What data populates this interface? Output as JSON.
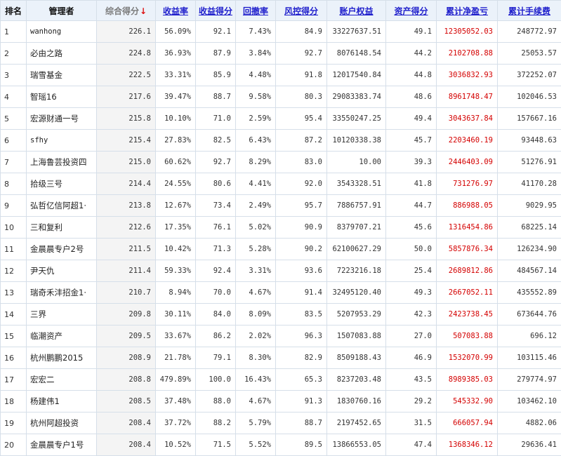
{
  "headers": {
    "rank": "排名",
    "manager": "管理者",
    "composite": "综合得分",
    "sort_arrow": "↓",
    "return_rate": "收益率",
    "return_score": "收益得分",
    "drawdown": "回撤率",
    "risk_score": "风控得分",
    "equity": "账户权益",
    "asset_score": "资产得分",
    "cum_pnl": "累计净盈亏",
    "cum_fee": "累计手续费"
  },
  "rows": [
    {
      "rank": "1",
      "manager": "wanhong",
      "composite": "226.1",
      "return_rate": "56.09%",
      "return_score": "92.1",
      "drawdown": "7.43%",
      "risk_score": "84.9",
      "equity": "33227637.51",
      "asset_score": "49.1",
      "cum_pnl": "12305052.03",
      "cum_fee": "248772.97"
    },
    {
      "rank": "2",
      "manager": "必由之路",
      "composite": "224.8",
      "return_rate": "36.93%",
      "return_score": "87.9",
      "drawdown": "3.84%",
      "risk_score": "92.7",
      "equity": "8076148.54",
      "asset_score": "44.2",
      "cum_pnl": "2102708.88",
      "cum_fee": "25053.57"
    },
    {
      "rank": "3",
      "manager": "瑞雪基金",
      "composite": "222.5",
      "return_rate": "33.31%",
      "return_score": "85.9",
      "drawdown": "4.48%",
      "risk_score": "91.8",
      "equity": "12017540.84",
      "asset_score": "44.8",
      "cum_pnl": "3036832.93",
      "cum_fee": "372252.07"
    },
    {
      "rank": "4",
      "manager": "智瑶16",
      "composite": "217.6",
      "return_rate": "39.47%",
      "return_score": "88.7",
      "drawdown": "9.58%",
      "risk_score": "80.3",
      "equity": "29083383.74",
      "asset_score": "48.6",
      "cum_pnl": "8961748.47",
      "cum_fee": "102046.53"
    },
    {
      "rank": "5",
      "manager": "宏源财通一号",
      "composite": "215.8",
      "return_rate": "10.10%",
      "return_score": "71.0",
      "drawdown": "2.59%",
      "risk_score": "95.4",
      "equity": "33550247.25",
      "asset_score": "49.4",
      "cum_pnl": "3043637.84",
      "cum_fee": "157667.16"
    },
    {
      "rank": "6",
      "manager": "sfhy",
      "composite": "215.4",
      "return_rate": "27.83%",
      "return_score": "82.5",
      "drawdown": "6.43%",
      "risk_score": "87.2",
      "equity": "10120338.38",
      "asset_score": "45.7",
      "cum_pnl": "2203460.19",
      "cum_fee": "93448.63"
    },
    {
      "rank": "7",
      "manager": "上海鲁芸投资四",
      "composite": "215.0",
      "return_rate": "60.62%",
      "return_score": "92.7",
      "drawdown": "8.29%",
      "risk_score": "83.0",
      "equity": "10.00",
      "asset_score": "39.3",
      "cum_pnl": "2446403.09",
      "cum_fee": "51276.91"
    },
    {
      "rank": "8",
      "manager": "拾级三号",
      "composite": "214.4",
      "return_rate": "24.55%",
      "return_score": "80.6",
      "drawdown": "4.41%",
      "risk_score": "92.0",
      "equity": "3543328.51",
      "asset_score": "41.8",
      "cum_pnl": "731276.97",
      "cum_fee": "41170.28"
    },
    {
      "rank": "9",
      "manager": "弘哲亿信阿超1·",
      "composite": "213.8",
      "return_rate": "12.67%",
      "return_score": "73.4",
      "drawdown": "2.49%",
      "risk_score": "95.7",
      "equity": "7886757.91",
      "asset_score": "44.7",
      "cum_pnl": "886988.05",
      "cum_fee": "9029.95"
    },
    {
      "rank": "10",
      "manager": "三和复利",
      "composite": "212.6",
      "return_rate": "17.35%",
      "return_score": "76.1",
      "drawdown": "5.02%",
      "risk_score": "90.9",
      "equity": "8379707.21",
      "asset_score": "45.6",
      "cum_pnl": "1316454.86",
      "cum_fee": "68225.14"
    },
    {
      "rank": "11",
      "manager": "金晨晨专户2号",
      "composite": "211.5",
      "return_rate": "10.42%",
      "return_score": "71.3",
      "drawdown": "5.28%",
      "risk_score": "90.2",
      "equity": "62100627.29",
      "asset_score": "50.0",
      "cum_pnl": "5857876.34",
      "cum_fee": "126234.90"
    },
    {
      "rank": "12",
      "manager": "尹天仇",
      "composite": "211.4",
      "return_rate": "59.33%",
      "return_score": "92.4",
      "drawdown": "3.31%",
      "risk_score": "93.6",
      "equity": "7223216.18",
      "asset_score": "25.4",
      "cum_pnl": "2689812.86",
      "cum_fee": "484567.14"
    },
    {
      "rank": "13",
      "manager": "瑞奇禾沣招金1·",
      "composite": "210.7",
      "return_rate": "8.94%",
      "return_score": "70.0",
      "drawdown": "4.67%",
      "risk_score": "91.4",
      "equity": "32495120.40",
      "asset_score": "49.3",
      "cum_pnl": "2667052.11",
      "cum_fee": "435552.89"
    },
    {
      "rank": "14",
      "manager": "三界",
      "composite": "209.8",
      "return_rate": "30.11%",
      "return_score": "84.0",
      "drawdown": "8.09%",
      "risk_score": "83.5",
      "equity": "5207953.29",
      "asset_score": "42.3",
      "cum_pnl": "2423738.45",
      "cum_fee": "673644.76"
    },
    {
      "rank": "15",
      "manager": "临潮资产",
      "composite": "209.5",
      "return_rate": "33.67%",
      "return_score": "86.2",
      "drawdown": "2.02%",
      "risk_score": "96.3",
      "equity": "1507083.88",
      "asset_score": "27.0",
      "cum_pnl": "507083.88",
      "cum_fee": "696.12"
    },
    {
      "rank": "16",
      "manager": "杭州鹏鹏2015",
      "composite": "208.9",
      "return_rate": "21.78%",
      "return_score": "79.1",
      "drawdown": "8.30%",
      "risk_score": "82.9",
      "equity": "8509188.43",
      "asset_score": "46.9",
      "cum_pnl": "1532070.99",
      "cum_fee": "103115.46"
    },
    {
      "rank": "17",
      "manager": "宏宏二",
      "composite": "208.8",
      "return_rate": "479.89%",
      "return_score": "100.0",
      "drawdown": "16.43%",
      "risk_score": "65.3",
      "equity": "8237203.48",
      "asset_score": "43.5",
      "cum_pnl": "8989385.03",
      "cum_fee": "279774.97"
    },
    {
      "rank": "18",
      "manager": "杨建伟1",
      "composite": "208.5",
      "return_rate": "37.48%",
      "return_score": "88.0",
      "drawdown": "4.67%",
      "risk_score": "91.3",
      "equity": "1830760.16",
      "asset_score": "29.2",
      "cum_pnl": "545332.90",
      "cum_fee": "103462.10"
    },
    {
      "rank": "19",
      "manager": "杭州阿超投资",
      "composite": "208.4",
      "return_rate": "37.72%",
      "return_score": "88.2",
      "drawdown": "5.79%",
      "risk_score": "88.7",
      "equity": "2197452.65",
      "asset_score": "31.5",
      "cum_pnl": "666057.94",
      "cum_fee": "4882.06"
    },
    {
      "rank": "20",
      "manager": "金晨晨专户1号",
      "composite": "208.4",
      "return_rate": "10.52%",
      "return_score": "71.5",
      "drawdown": "5.52%",
      "risk_score": "89.5",
      "equity": "13866553.05",
      "asset_score": "47.4",
      "cum_pnl": "1368346.12",
      "cum_fee": "29636.41"
    }
  ]
}
